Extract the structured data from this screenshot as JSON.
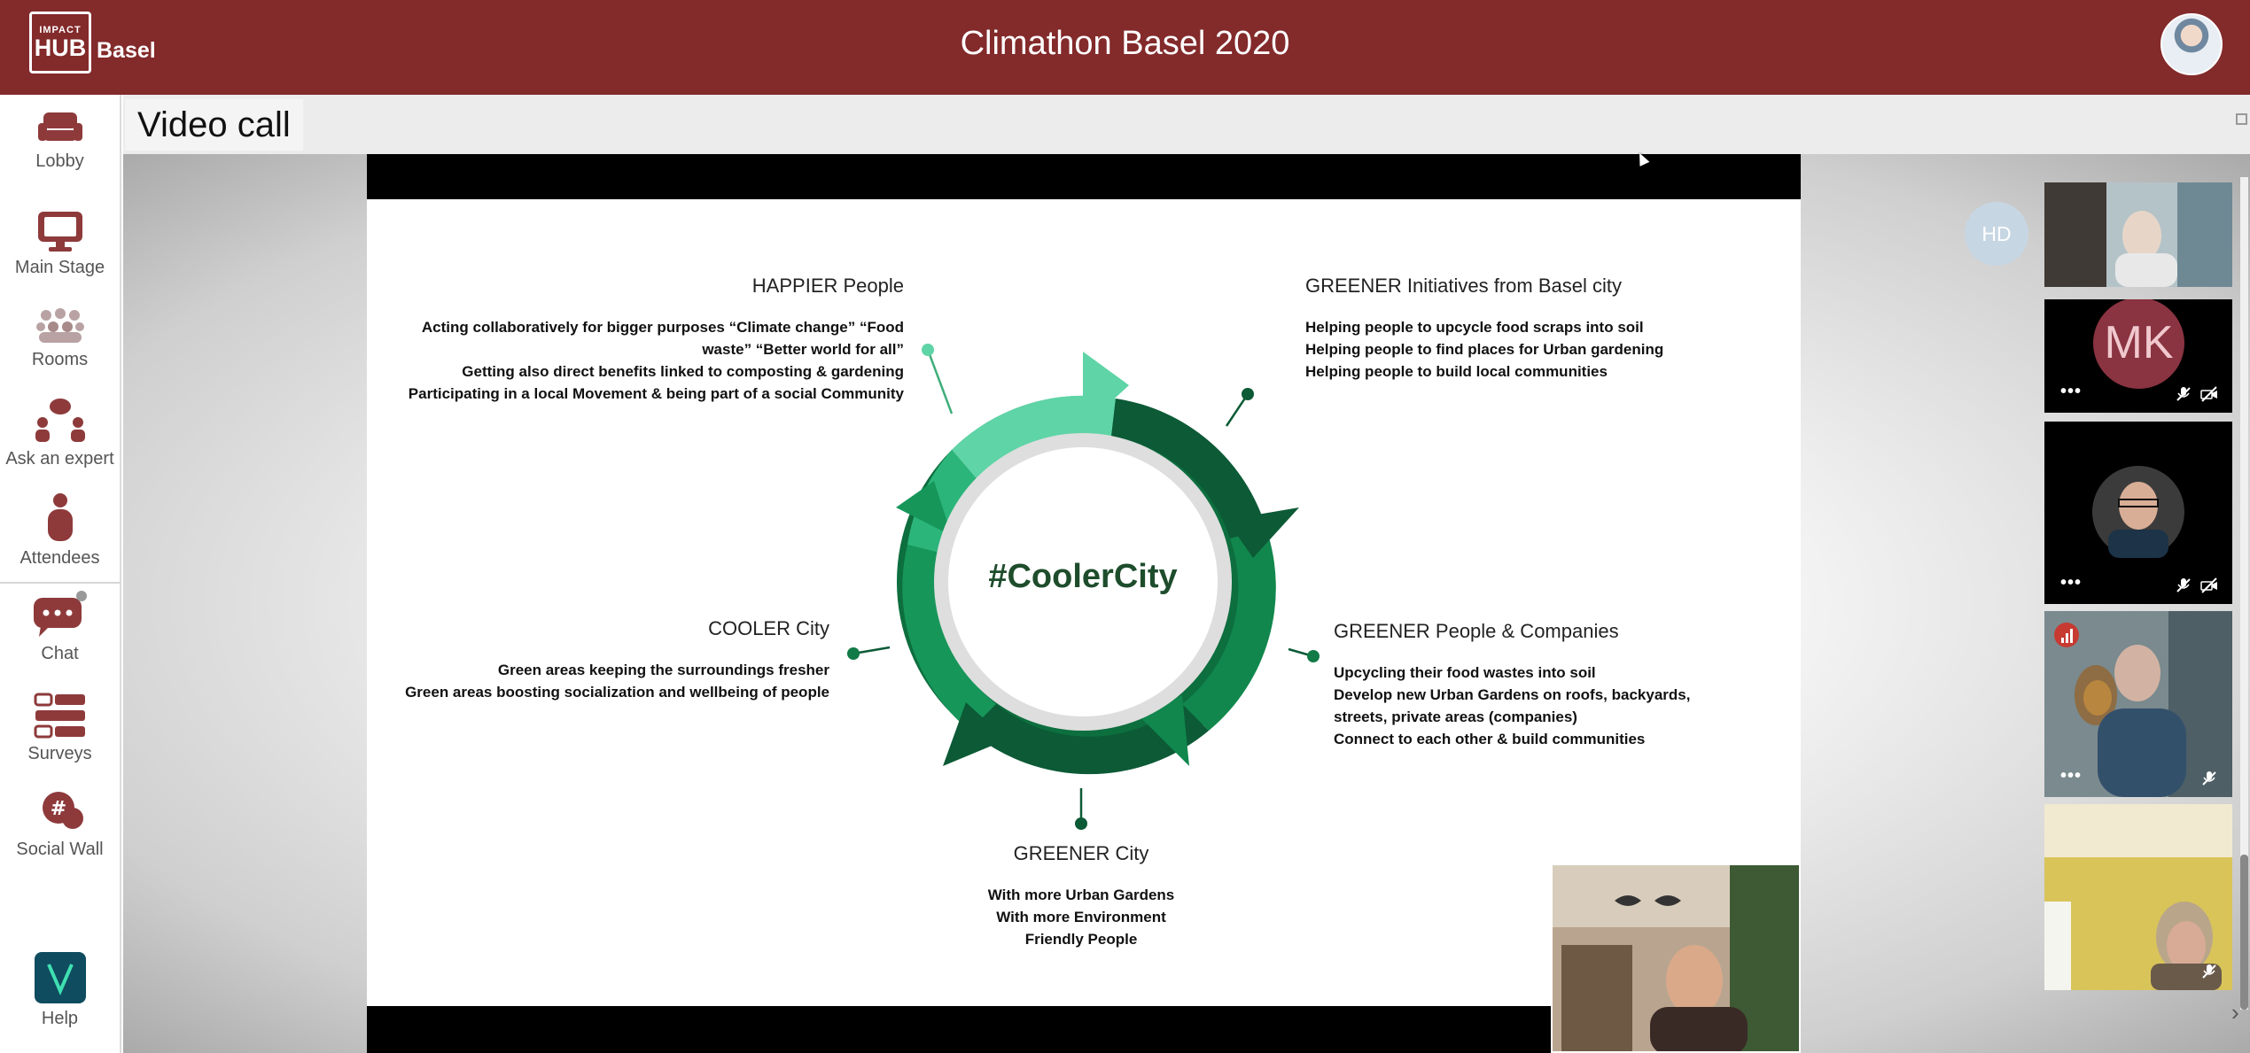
{
  "header": {
    "logo_line1": "IMPACT",
    "logo_line2": "HUB",
    "logo_city": "Basel",
    "event_title": "Climathon Basel 2020"
  },
  "sidebar": {
    "items": [
      {
        "label": "Lobby",
        "icon": "sofa-icon"
      },
      {
        "label": "Main Stage",
        "icon": "monitor-icon"
      },
      {
        "label": "Rooms",
        "icon": "group-icon"
      },
      {
        "label": "Ask an expert",
        "icon": "chat-expert-icon"
      },
      {
        "label": "Attendees",
        "icon": "person-icon"
      },
      {
        "label": "Chat",
        "icon": "chat-bubbles-icon"
      },
      {
        "label": "Surveys",
        "icon": "survey-list-icon"
      },
      {
        "label": "Social Wall",
        "icon": "hashtag-bubble-icon"
      },
      {
        "label": "Help",
        "icon": "help-v-icon"
      }
    ]
  },
  "video": {
    "title": "Video call"
  },
  "slide": {
    "center_text": "#CoolerCity",
    "happier": {
      "title": "HAPPIER People",
      "lines": [
        "Acting collaboratively for bigger purposes “Climate change” “Food",
        "waste” “Better world for all”",
        "Getting also direct benefits linked to composting & gardening",
        "Participating in a local Movement & being part of a social Community"
      ]
    },
    "greener_initiatives": {
      "title": "GREENER Initiatives from Basel city",
      "lines": [
        "Helping people to upcycle food scraps into soil",
        "Helping people to find places for Urban gardening",
        "Helping people to build local communities"
      ]
    },
    "cooler_city": {
      "title": "COOLER City",
      "lines": [
        "Green areas keeping the surroundings fresher",
        "Green areas boosting socialization and wellbeing of people"
      ]
    },
    "greener_people": {
      "title": "GREENER People & Companies",
      "lines": [
        "Upcycling their food wastes into soil",
        "Develop new Urban Gardens on roofs, backyards,",
        "streets, private areas (companies)",
        "Connect to each other & build communities"
      ]
    },
    "greener_city": {
      "title": "GREENER City",
      "lines": [
        "With more Urban Gardens",
        "With more Environment",
        "Friendly People"
      ]
    }
  },
  "participants": {
    "hd_initials": "HD",
    "mk_initials": "MK",
    "more_label": "•••"
  },
  "colors": {
    "header": "#832a2b",
    "sidebar_icon": "#8e3a3b",
    "ring_light": "#5fd4a6",
    "ring_mid": "#11874d",
    "ring_dark": "#0c5a36"
  }
}
